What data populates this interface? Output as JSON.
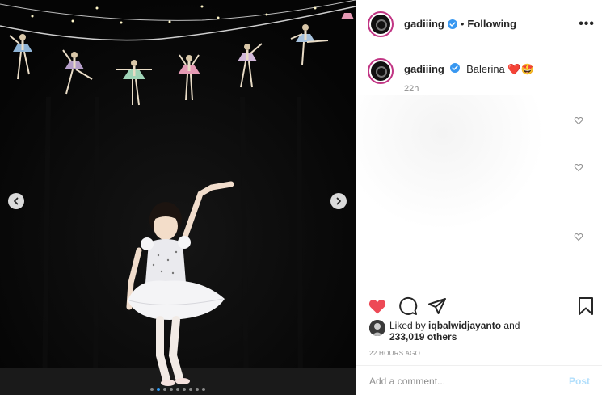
{
  "post": {
    "username": "gadiiing",
    "follow_status": "Following",
    "separator": "•",
    "more_label": "•••"
  },
  "caption": {
    "username": "gadiiing",
    "text": "Balerina",
    "emoji": "❤️🤩",
    "time_ago": "22h"
  },
  "likes": {
    "prefix": "Liked by",
    "user": "iqbalwidjayanto",
    "conjunction": "and",
    "count": "233,019 others"
  },
  "timestamp": "22 HOURS AGO",
  "comment": {
    "placeholder": "Add a comment...",
    "post_label": "Post"
  },
  "carousel": {
    "total_slides": 9,
    "active_index": 1
  },
  "colors": {
    "liked_heart": "#ed4956",
    "verified_badge": "#3897f0",
    "avatar_ring": "#c13584",
    "active_dot": "#2f9bf6"
  },
  "icons": [
    "verified-badge-icon",
    "more-options-icon",
    "heart-icon",
    "comment-icon",
    "share-icon",
    "bookmark-icon",
    "chevron-left-icon",
    "chevron-right-icon"
  ]
}
